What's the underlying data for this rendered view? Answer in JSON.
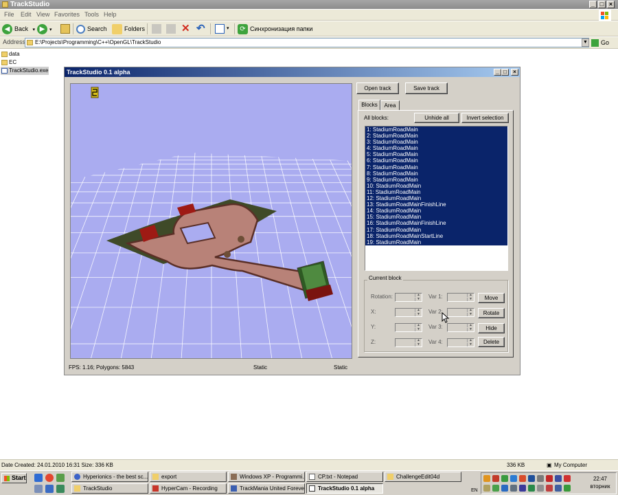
{
  "explorer": {
    "title": "TrackStudio",
    "menu": [
      "File",
      "Edit",
      "View",
      "Favorites",
      "Tools",
      "Help"
    ],
    "toolbar": {
      "back": "Back",
      "search": "Search",
      "folders": "Folders",
      "sync": "Синхронизация папки"
    },
    "address": {
      "label": "Address",
      "path": "E:\\Projects\\Programming\\C++\\OpenGL\\TrackStudio",
      "go": "Go"
    },
    "files": [
      "data",
      "EC",
      "TrackStudio.exe"
    ],
    "status": {
      "left": "Date Created: 24.01.2010 16:31 Size: 336 KB",
      "size": "336 KB",
      "location": "My Computer"
    }
  },
  "app": {
    "title": "TrackStudio 0.1 alpha",
    "buttons": {
      "open": "Open track",
      "save": "Save track",
      "unhide": "Unhide all",
      "invert": "Invert selection",
      "move": "Move",
      "rotate": "Rotate",
      "hide": "Hide",
      "delete": "Delete"
    },
    "tabs": [
      "Blocks",
      "Area"
    ],
    "all_blocks_label": "All blocks:",
    "blocks": [
      "1: StadiumRoadMain",
      "2: StadiumRoadMain",
      "3: StadiumRoadMain",
      "4: StadiumRoadMain",
      "5: StadiumRoadMain",
      "6: StadiumRoadMain",
      "7: StadiumRoadMain",
      "8: StadiumRoadMain",
      "9: StadiumRoadMain",
      "10: StadiumRoadMain",
      "11: StadiumRoadMain",
      "12: StadiumRoadMain",
      "13: StadiumRoadMainFinishLine",
      "14: StadiumRoadMain",
      "15: StadiumRoadMain",
      "16: StadiumRoadMainFinishLine",
      "17: StadiumRoadMain",
      "18: StadiumRoadMainStartLine",
      "19: StadiumRoadMain"
    ],
    "current_block": {
      "legend": "Current block",
      "fields": [
        "Rotation:",
        "X:",
        "Y:",
        "Z:"
      ],
      "vars": [
        "Var 1:",
        "Var 2:",
        "Var 3:",
        "Var 4:"
      ]
    },
    "status": {
      "fps": "FPS: 1.16; Polygons: 5843",
      "s1": "Static",
      "s2": "Static"
    }
  },
  "taskbar": {
    "start": "Start",
    "tasks_row1": [
      "Hyperionics - the best sc...",
      "export",
      "Windows XP - Programmi...",
      "CP.txt - Notepad",
      "ChallengeEdit04d"
    ],
    "tasks_row2": [
      "TrackStudio",
      "HyperCam - Recording",
      "TrackMania United Forever",
      "TrackStudio 0.1 alpha"
    ],
    "lang": "EN",
    "time": "22:47",
    "day": "вторник"
  }
}
